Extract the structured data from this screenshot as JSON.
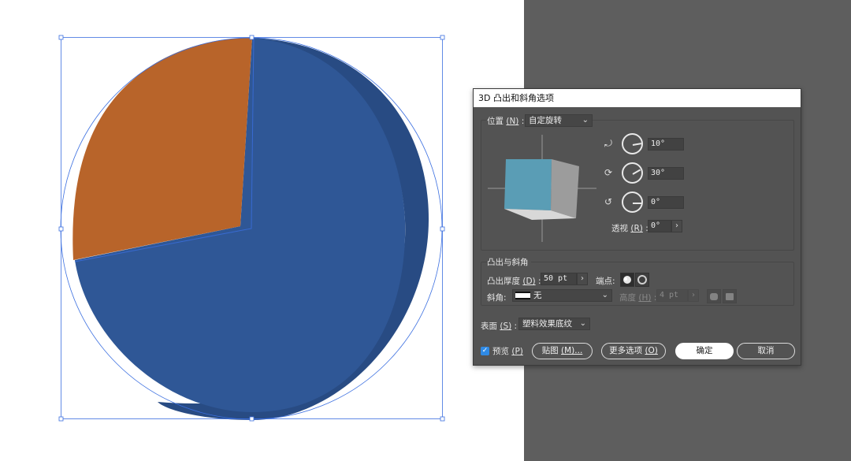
{
  "dialog": {
    "title": "3D 凸出和斜角选项",
    "position": {
      "label": "位置",
      "key": "(N)",
      "colon": ":",
      "value": "自定旋转"
    },
    "rotation": {
      "x": {
        "value": "10°",
        "icon": "rotate-x-icon"
      },
      "y": {
        "value": "30°",
        "icon": "rotate-y-icon"
      },
      "z": {
        "value": "0°",
        "icon": "rotate-z-icon"
      }
    },
    "perspective": {
      "label": "透视",
      "key": "(R)",
      "colon": ":",
      "value": "0°"
    },
    "extrude_section": {
      "label": "凸出与斜角"
    },
    "extrude_depth": {
      "label": "凸出厚度",
      "key": "(D)",
      "colon": ":",
      "value": "50 pt"
    },
    "cap": {
      "label": "端点",
      "colon": ":"
    },
    "bevel": {
      "label": "斜角",
      "colon": ":",
      "value": "无"
    },
    "height": {
      "label": "高度",
      "key": "(H)",
      "colon": ":",
      "value": "4 pt"
    },
    "surface": {
      "label": "表面",
      "key": "(S)",
      "colon": ":",
      "value": "塑料效果底纹"
    },
    "preview": {
      "label": "预览",
      "key": "(P)",
      "checked": true
    },
    "buttons": {
      "map_label": "贴图",
      "map_key": "(M)...",
      "more_label": "更多选项",
      "more_key": "(O)",
      "ok": "确定",
      "cancel": "取消"
    }
  },
  "colors": {
    "pie_blue": "#2f5796",
    "pie_orange": "#b8642a",
    "cube_front": "#5a9db5",
    "selection": "#3b6fe0",
    "dialog_bg": "#535353",
    "pasteboard": "#5e5e5e",
    "checkbox": "#2f8ae5"
  }
}
